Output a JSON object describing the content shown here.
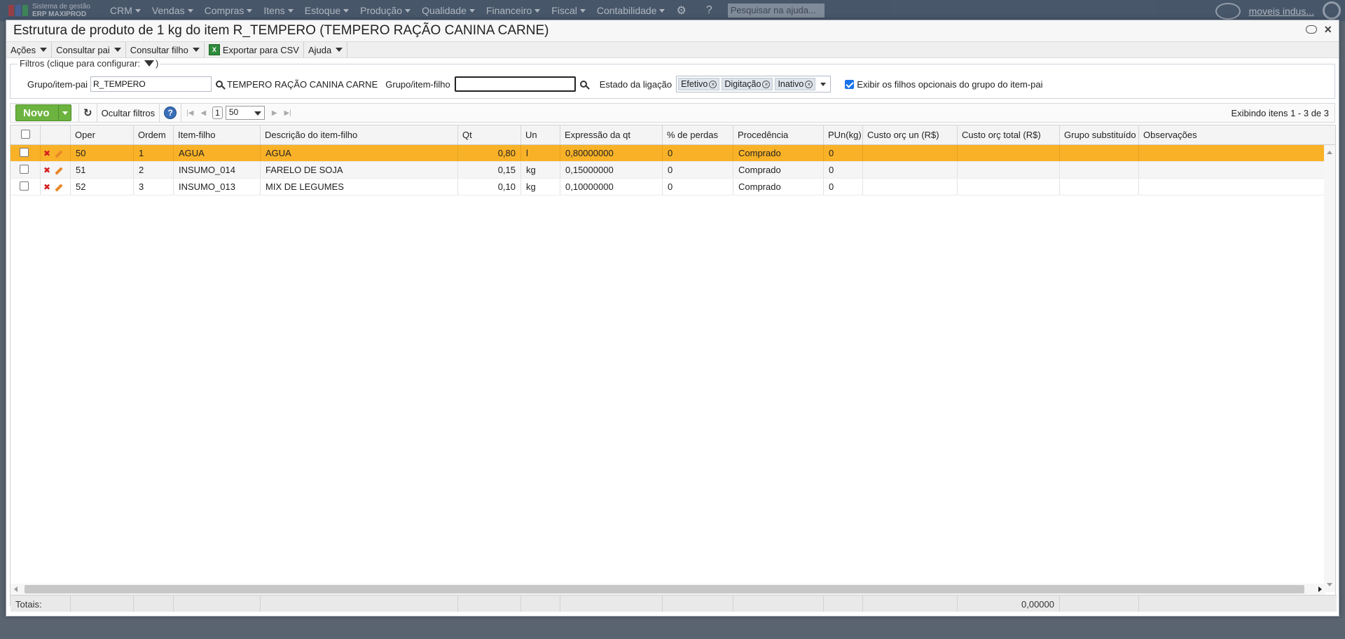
{
  "app": {
    "logo_line1": "Sistema de gestão",
    "logo_line2": "ERP MAXIPROD",
    "menu": [
      "CRM",
      "Vendas",
      "Compras",
      "Itens",
      "Estoque",
      "Produção",
      "Qualidade",
      "Financeiro",
      "Fiscal",
      "Contabilidade"
    ],
    "search_placeholder": "Pesquisar na ajuda...",
    "user": "moveis indus...",
    "logo_colors": [
      "#c0272d",
      "#3b5ea8",
      "#2b9a4a"
    ]
  },
  "window": {
    "title": "Estrutura de produto de 1 kg do item R_TEMPERO (TEMPERO RAÇÃO CANINA CARNE)"
  },
  "toolbar": {
    "acoes": "Ações",
    "consultar_pai": "Consultar pai",
    "consultar_filho": "Consultar filho",
    "exportar_csv": "Exportar para CSV",
    "ajuda": "Ajuda"
  },
  "filters": {
    "legend": "Filtros (clique para configurar:",
    "legend_close": ")",
    "pai_label": "Grupo/item-pai",
    "pai_value": "R_TEMPERO",
    "pai_description": "TEMPERO RAÇÃO CANINA CARNE",
    "filho_label": "Grupo/item-filho",
    "filho_value": "",
    "estado_label": "Estado da ligação",
    "estado_chips": [
      "Efetivo",
      "Digitação",
      "Inativo"
    ],
    "opcionais_label": "Exibir os filhos opcionais do grupo do item-pai",
    "opcionais_checked": true
  },
  "grid_toolbar": {
    "novo": "Novo",
    "ocultar_filtros": "Ocultar filtros",
    "help": "?",
    "page": "1",
    "page_size": "50",
    "showing": "Exibindo itens 1 - 3 de 3"
  },
  "grid": {
    "columns": [
      "Oper",
      "Ordem",
      "Item-filho",
      "Descrição do item-filho",
      "Qt",
      "Un",
      "Expressão da qt",
      "% de perdas",
      "Procedência",
      "PUn(kg)",
      "Custo orç un (R$)",
      "Custo orç total (R$)",
      "Grupo substituído",
      "Observações"
    ],
    "rows": [
      {
        "oper": "50",
        "ordem": "1",
        "item": "AGUA",
        "descricao": "AGUA",
        "qt": "0,80",
        "un": "l",
        "expressao": "0,80000000",
        "perdas": "0",
        "procedencia": "Comprado",
        "pun": "0",
        "custo_un": "",
        "custo_total": "",
        "grupo": "",
        "obs": ""
      },
      {
        "oper": "51",
        "ordem": "2",
        "item": "INSUMO_014",
        "descricao": "FARELO DE SOJA",
        "qt": "0,15",
        "un": "kg",
        "expressao": "0,15000000",
        "perdas": "0",
        "procedencia": "Comprado",
        "pun": "0",
        "custo_un": "",
        "custo_total": "",
        "grupo": "",
        "obs": ""
      },
      {
        "oper": "52",
        "ordem": "3",
        "item": "INSUMO_013",
        "descricao": "MIX DE LEGUMES",
        "qt": "0,10",
        "un": "kg",
        "expressao": "0,10000000",
        "perdas": "0",
        "procedencia": "Comprado",
        "pun": "0",
        "custo_un": "",
        "custo_total": "",
        "grupo": "",
        "obs": ""
      }
    ],
    "totals_label": "Totais:",
    "totals_custo_total": "0,00000",
    "selected_row_color": "#f9b227"
  }
}
